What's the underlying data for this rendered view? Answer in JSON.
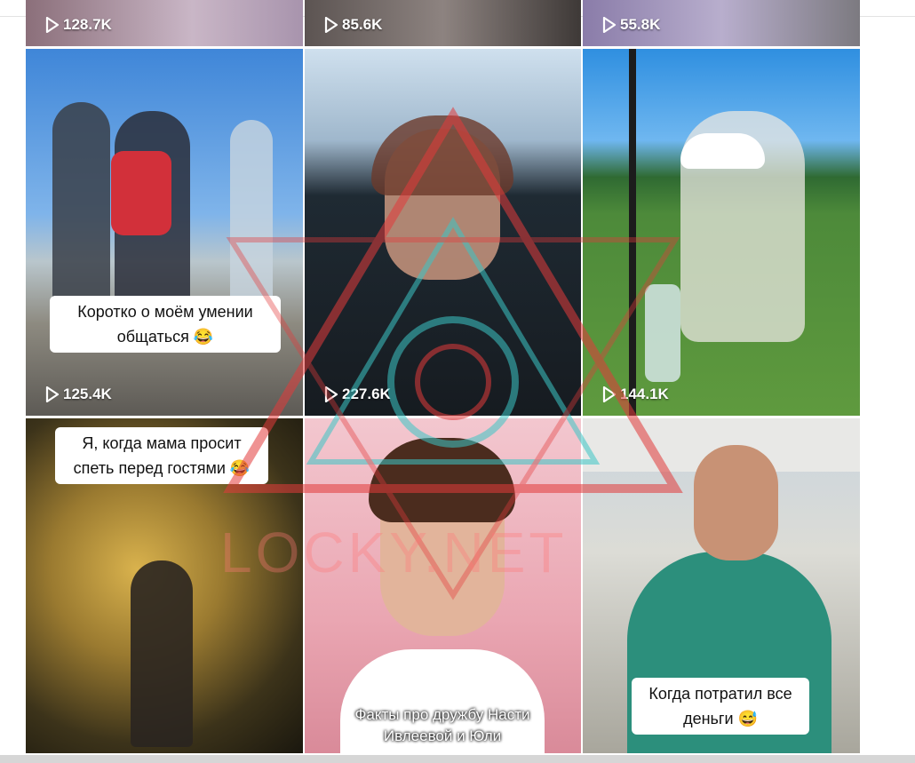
{
  "tiles": [
    {
      "views": "128.7K",
      "caption": ""
    },
    {
      "views": "85.6K",
      "caption": ""
    },
    {
      "views": "55.8K",
      "caption": ""
    },
    {
      "views": "125.4K",
      "caption": "Коротко о моём умении общаться 😂"
    },
    {
      "views": "227.6K",
      "caption": ""
    },
    {
      "views": "144.1K",
      "caption": ""
    },
    {
      "views": "",
      "caption": "Я, когда мама просит спеть перед гостями 😂"
    },
    {
      "views": "",
      "caption": "Факты про дружбу Насти Ивлеевой и Юли"
    },
    {
      "views": "",
      "caption": "Когда потратил все деньги 😅"
    }
  ],
  "watermark": "LOCKY.NET",
  "icons": {
    "play": "play-icon"
  }
}
